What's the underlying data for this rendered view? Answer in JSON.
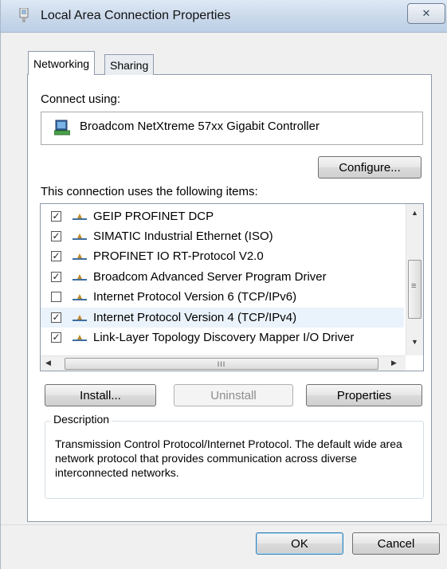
{
  "window": {
    "title": "Local Area Connection Properties",
    "close_symbol": "✕"
  },
  "tabs": [
    {
      "label": "Networking",
      "active": true
    },
    {
      "label": "Sharing",
      "active": false
    }
  ],
  "connect_using": {
    "label": "Connect using:",
    "adapter": "Broadcom NetXtreme 57xx Gigabit Controller",
    "configure_button": "Configure..."
  },
  "items_section": {
    "label": "This connection uses the following items:",
    "items": [
      {
        "label": "GEIP PROFINET DCP",
        "checked": true,
        "selected": false
      },
      {
        "label": "SIMATIC Industrial Ethernet (ISO)",
        "checked": true,
        "selected": false
      },
      {
        "label": "PROFINET IO RT-Protocol V2.0",
        "checked": true,
        "selected": false
      },
      {
        "label": "Broadcom Advanced Server Program Driver",
        "checked": true,
        "selected": false
      },
      {
        "label": "Internet Protocol Version 6 (TCP/IPv6)",
        "checked": false,
        "selected": false
      },
      {
        "label": "Internet Protocol Version 4 (TCP/IPv4)",
        "checked": true,
        "selected": true
      },
      {
        "label": "Link-Layer Topology Discovery Mapper I/O Driver",
        "checked": true,
        "selected": false
      }
    ],
    "scroll_thumb_grip": "III",
    "vscroll_grip": "≡"
  },
  "buttons": {
    "install": "Install...",
    "uninstall": "Uninstall",
    "properties": "Properties",
    "ok": "OK",
    "cancel": "Cancel"
  },
  "description": {
    "legend": "Description",
    "text": "Transmission Control Protocol/Internet Protocol. The default wide area network protocol that provides communication across diverse interconnected networks."
  },
  "colors": {
    "titlebar": "#cddbec",
    "selection": "#eaf2fb",
    "protocol_icon": "#3f6f9e"
  }
}
